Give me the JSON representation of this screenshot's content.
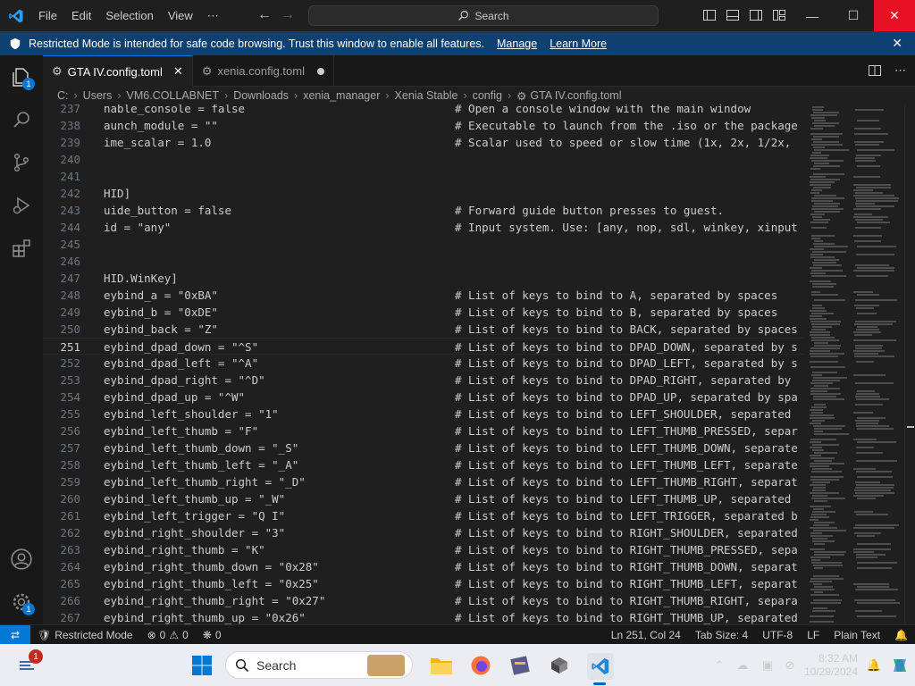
{
  "titlebar": {
    "menu": [
      "File",
      "Edit",
      "Selection",
      "View",
      "⋯"
    ],
    "search_label": "Search"
  },
  "banner": {
    "text": "Restricted Mode is intended for safe code browsing. Trust this window to enable all features.",
    "manage": "Manage",
    "learn_more": "Learn More"
  },
  "activity": {
    "explorer_badge": "1",
    "settings_badge": "1"
  },
  "tabs": [
    {
      "label": "GTA IV.config.toml",
      "active": true
    },
    {
      "label": "xenia.config.toml",
      "active": false
    }
  ],
  "breadcrumb": [
    "C:",
    "Users",
    "VM6.COLLABNET",
    "Downloads",
    "xenia_manager",
    "Xenia Stable",
    "config",
    "GTA IV.config.toml"
  ],
  "editor": {
    "current_line": 251,
    "lines": [
      {
        "n": "237",
        "code": "nable_console = false",
        "comment": "# Open a console window with the main window"
      },
      {
        "n": "238",
        "code": "aunch_module = \"\"",
        "comment": "# Executable to launch from the .iso or the package"
      },
      {
        "n": "239",
        "code": "ime_scalar = 1.0",
        "comment": "# Scalar used to speed or slow time (1x, 2x, 1/2x,"
      },
      {
        "n": "240",
        "code": "",
        "comment": ""
      },
      {
        "n": "241",
        "code": "",
        "comment": ""
      },
      {
        "n": "242",
        "code": "HID]",
        "comment": ""
      },
      {
        "n": "243",
        "code": "uide_button = false",
        "comment": "# Forward guide button presses to guest."
      },
      {
        "n": "244",
        "code": "id = \"any\"",
        "comment": "# Input system. Use: [any, nop, sdl, winkey, xinput"
      },
      {
        "n": "245",
        "code": "",
        "comment": ""
      },
      {
        "n": "246",
        "code": "",
        "comment": ""
      },
      {
        "n": "247",
        "code": "HID.WinKey]",
        "comment": ""
      },
      {
        "n": "248",
        "code": "eybind_a = \"0xBA\"",
        "comment": "# List of keys to bind to A, separated by spaces"
      },
      {
        "n": "249",
        "code": "eybind_b = \"0xDE\"",
        "comment": "# List of keys to bind to B, separated by spaces"
      },
      {
        "n": "250",
        "code": "eybind_back = \"Z\"",
        "comment": "# List of keys to bind to BACK, separated by spaces"
      },
      {
        "n": "251",
        "code": "eybind_dpad_down = \"^S\"",
        "comment": "# List of keys to bind to DPAD_DOWN, separated by s"
      },
      {
        "n": "252",
        "code": "eybind_dpad_left = \"^A\"",
        "comment": "# List of keys to bind to DPAD_LEFT, separated by s"
      },
      {
        "n": "253",
        "code": "eybind_dpad_right = \"^D\"",
        "comment": "# List of keys to bind to DPAD_RIGHT, separated by"
      },
      {
        "n": "254",
        "code": "eybind_dpad_up = \"^W\"",
        "comment": "# List of keys to bind to DPAD_UP, separated by spa"
      },
      {
        "n": "255",
        "code": "eybind_left_shoulder = \"1\"",
        "comment": "# List of keys to bind to LEFT_SHOULDER, separated"
      },
      {
        "n": "256",
        "code": "eybind_left_thumb = \"F\"",
        "comment": "# List of keys to bind to LEFT_THUMB_PRESSED, separ"
      },
      {
        "n": "257",
        "code": "eybind_left_thumb_down = \"_S\"",
        "comment": "# List of keys to bind to LEFT_THUMB_DOWN, separate"
      },
      {
        "n": "258",
        "code": "eybind_left_thumb_left = \"_A\"",
        "comment": "# List of keys to bind to LEFT_THUMB_LEFT, separate"
      },
      {
        "n": "259",
        "code": "eybind_left_thumb_right = \"_D\"",
        "comment": "# List of keys to bind to LEFT_THUMB_RIGHT, separat"
      },
      {
        "n": "260",
        "code": "eybind_left_thumb_up = \"_W\"",
        "comment": "# List of keys to bind to LEFT_THUMB_UP, separated"
      },
      {
        "n": "261",
        "code": "eybind_left_trigger = \"Q I\"",
        "comment": "# List of keys to bind to LEFT_TRIGGER, separated b"
      },
      {
        "n": "262",
        "code": "eybind_right_shoulder = \"3\"",
        "comment": "# List of keys to bind to RIGHT_SHOULDER, separated"
      },
      {
        "n": "263",
        "code": "eybind_right_thumb = \"K\"",
        "comment": "# List of keys to bind to RIGHT_THUMB_PRESSED, sepa"
      },
      {
        "n": "264",
        "code": "eybind_right_thumb_down = \"0x28\"",
        "comment": "# List of keys to bind to RIGHT_THUMB_DOWN, separat"
      },
      {
        "n": "265",
        "code": "eybind_right_thumb_left = \"0x25\"",
        "comment": "# List of keys to bind to RIGHT_THUMB_LEFT, separat"
      },
      {
        "n": "266",
        "code": "eybind_right_thumb_right = \"0x27\"",
        "comment": "# List of keys to bind to RIGHT_THUMB_RIGHT, separa"
      },
      {
        "n": "267",
        "code": "eybind_right_thumb_up = \"0x26\"",
        "comment": "# List of keys to bind to RIGHT_THUMB_UP, separated"
      }
    ]
  },
  "statusbar": {
    "restricted": "Restricted Mode",
    "errors": "0",
    "warnings": "0",
    "ports": "0",
    "position": "Ln 251, Col 24",
    "tab_size": "Tab Size: 4",
    "encoding": "UTF-8",
    "eol": "LF",
    "language": "Plain Text"
  },
  "taskbar": {
    "notification_badge": "1",
    "search_label": "Search",
    "time": "8:32 AM",
    "date": "10/29/2024"
  },
  "colors": {
    "accent": "#0078d4",
    "banner": "#0e4172",
    "close": "#e81123"
  }
}
